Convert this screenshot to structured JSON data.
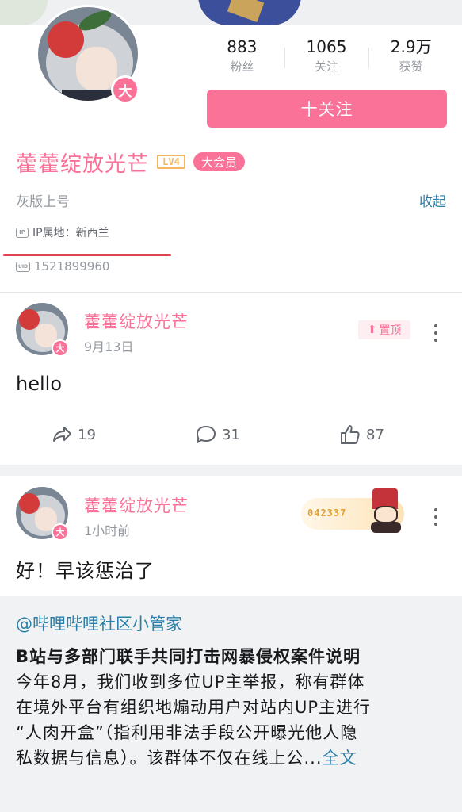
{
  "profile": {
    "stats": [
      {
        "value": "883",
        "label": "粉丝"
      },
      {
        "value": "1065",
        "label": "关注"
      },
      {
        "value": "2.9万",
        "label": "获赞"
      }
    ],
    "follow_label": "十关注",
    "vip_avatar_mark": "大",
    "name": "藿藿绽放光芒",
    "level": "LV4",
    "vip_label": "大会员",
    "sign": "灰版上号",
    "collapse_label": "收起",
    "ip_icon": "IP",
    "ip_text": "IP属地：新西兰",
    "uid_icon": "UID",
    "uid": "1521899960",
    "accent_color": "#fb7299",
    "link_color": "#2a7fa8"
  },
  "posts": [
    {
      "author": "藿藿绽放光芒",
      "time": "9月13日",
      "pin_label": "置顶",
      "text": "hello",
      "vip_mark": "大",
      "actions": {
        "share": "19",
        "comment": "31",
        "like": "87"
      }
    },
    {
      "author": "藿藿绽放光芒",
      "time": "1小时前",
      "fan_medal_number": "042337",
      "text": "好！早该惩治了",
      "vip_mark": "大",
      "forward": {
        "author": "@哔哩哔哩社区小管家",
        "title": "B站与多部门联手共同打击网暴侵权案件说明",
        "body_lines": [
          "今年8月，我们收到多位UP主举报，称有群体",
          "在境外平台有组织地煽动用户对站内UP主进行",
          "“人肉开盒”（指利用非法手段公开曝光他人隐",
          "私数据与信息）。该群体不仅在线上公..."
        ],
        "more_label": "全文"
      }
    }
  ]
}
